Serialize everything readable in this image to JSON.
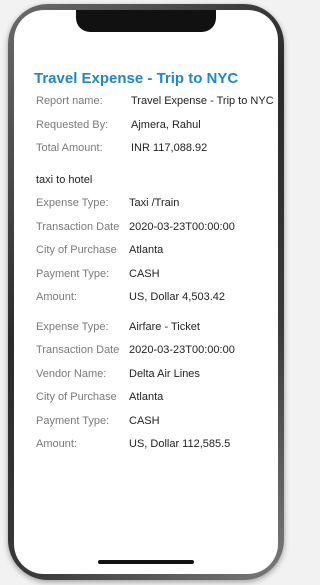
{
  "report": {
    "title": "Travel Expense - Trip to NYC",
    "fields": [
      {
        "label": "Report name:",
        "value": "Travel Expense - Trip to NYC"
      },
      {
        "label": "Requested By:",
        "value": "Ajmera, Rahul"
      },
      {
        "label": "Total Amount:",
        "value": "INR 117,088.92"
      }
    ],
    "section_title": "taxi to hotel"
  },
  "expenses": [
    {
      "rows": [
        {
          "label": "Expense Type:",
          "value": "Taxi /Train"
        },
        {
          "label": "Transaction Date",
          "value": "2020-03-23T00:00:00"
        },
        {
          "label": "City of Purchase",
          "value": "Atlanta"
        },
        {
          "label": "Payment Type:",
          "value": "CASH"
        },
        {
          "label": "Amount:",
          "value": "US, Dollar 4,503.42"
        }
      ]
    },
    {
      "rows": [
        {
          "label": "Expense Type:",
          "value": "Airfare - Ticket"
        },
        {
          "label": "Transaction Date",
          "value": "2020-03-23T00:00:00"
        },
        {
          "label": "Vendor Name:",
          "value": "Delta Air Lines"
        },
        {
          "label": "City of Purchase",
          "value": "Atlanta"
        },
        {
          "label": "Payment Type:",
          "value": "CASH"
        },
        {
          "label": "Amount:",
          "value": "US, Dollar 112,585.5"
        }
      ]
    }
  ]
}
